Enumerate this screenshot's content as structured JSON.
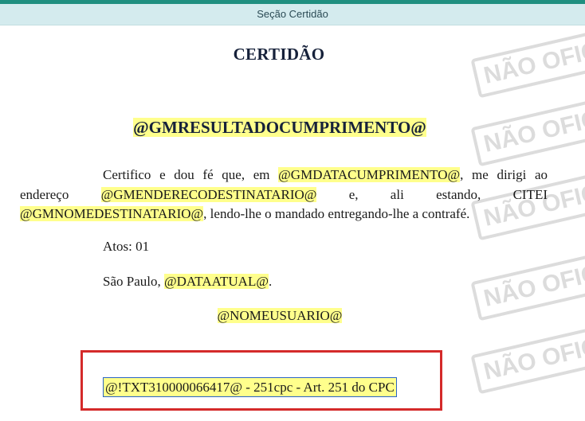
{
  "section_header": "Seção Certidão",
  "document": {
    "title": "CERTIDÃO",
    "result_placeholder": "@GMRESULTADOCUMPRIMENTO@",
    "paragraph": {
      "t1": "Certifico e dou fé que, em ",
      "v1": "@GMDATACUMPRIMENTO@",
      "t2": ", me dirigi ao endereço ",
      "v2": "@GMENDERECODESTINATARIO@",
      "t3": " e, ali estando, CITEI ",
      "v3": "@GMNOMEDESTINATARIO@",
      "t4": ", lendo-lhe o mandado entregando-lhe a contrafé."
    },
    "atos": "Atos: 01",
    "local_prefix": "São Paulo, ",
    "date_placeholder": "@DATAATUAL@",
    "local_suffix": ".",
    "user_placeholder": "@NOMEUSUARIO@",
    "text_field": "@!TXT310000066417@ - 251cpc - Art. 251 do CPC"
  },
  "watermark": "NÃO OFICIAL",
  "colors": {
    "highlight": "#ffff8c",
    "header_bg": "#d4ebee",
    "top_strip": "#1f8f80",
    "red_box": "#d42a2a",
    "field_border": "#2a63c6"
  }
}
